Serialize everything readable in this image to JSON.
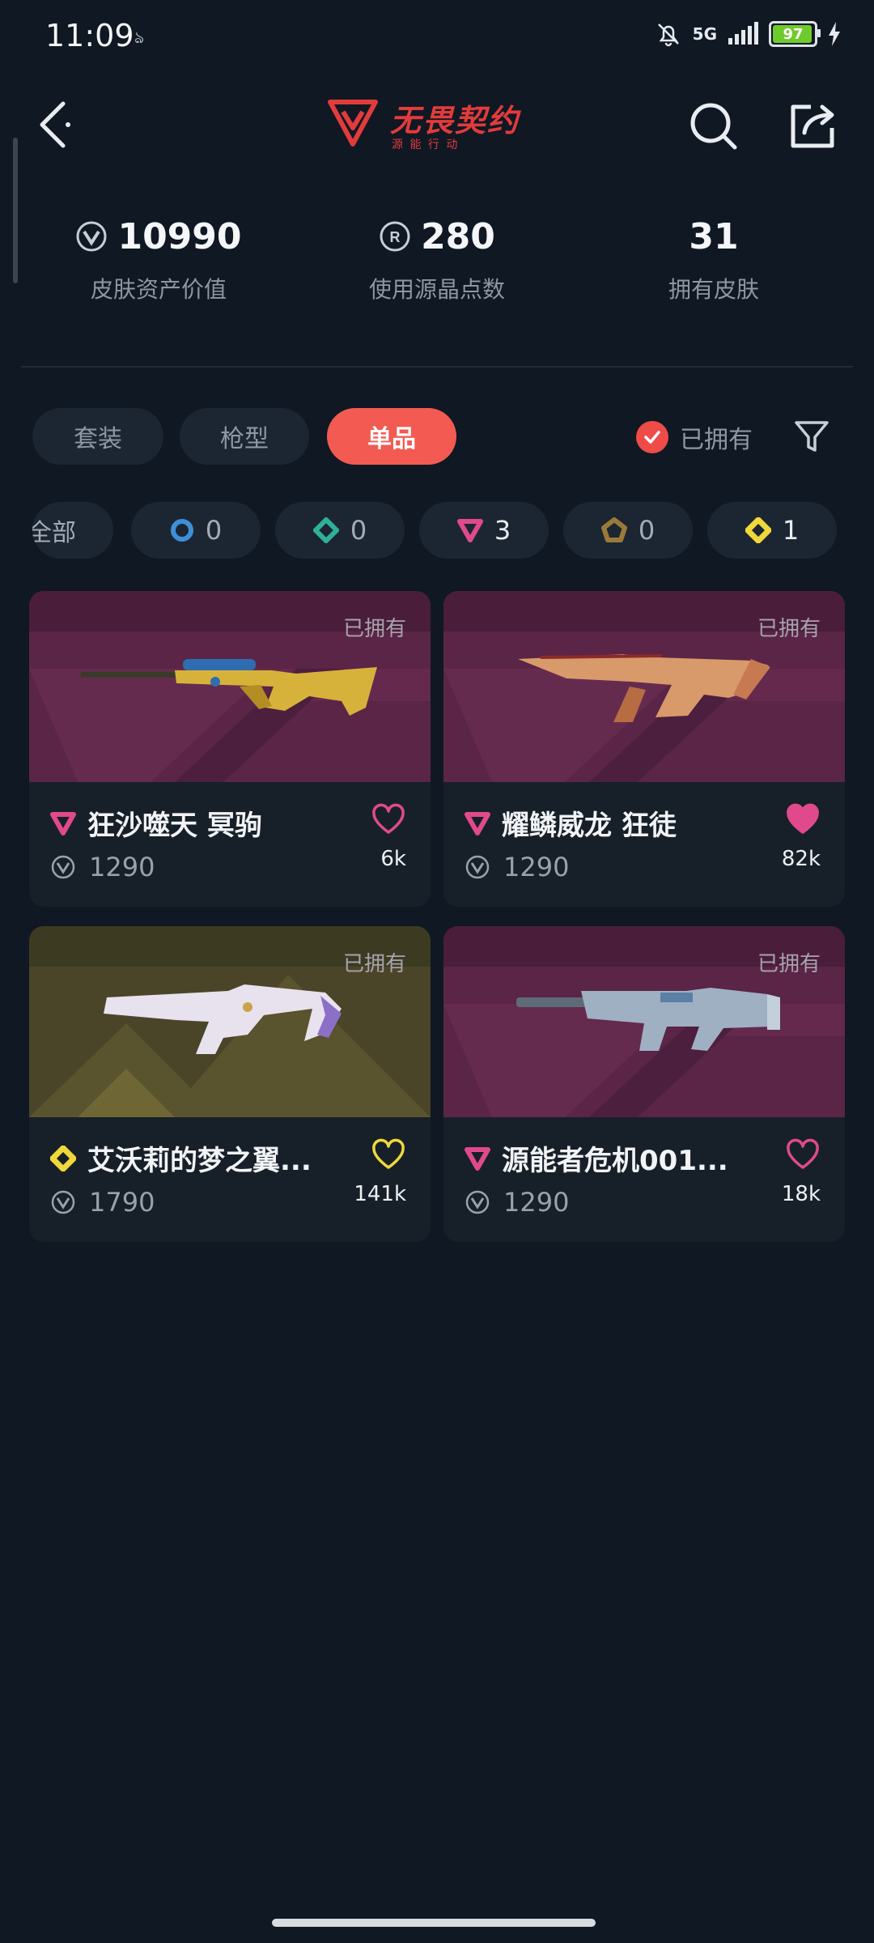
{
  "status_bar": {
    "time": "11:09",
    "network": "5G",
    "battery": "97"
  },
  "header": {
    "logo_title": "无畏契约",
    "logo_subtitle": "源 能 行 动"
  },
  "stats": [
    {
      "value": "10990",
      "label": "皮肤资产价值",
      "icon": "vp-coin-icon"
    },
    {
      "value": "280",
      "label": "使用源晶点数",
      "icon": "radianite-icon"
    },
    {
      "value": "31",
      "label": "拥有皮肤"
    }
  ],
  "tabs": [
    {
      "label": "套装",
      "active": false
    },
    {
      "label": "枪型",
      "active": false
    },
    {
      "label": "单品",
      "active": true
    }
  ],
  "owned_filter": {
    "label": "已拥有",
    "checked": true
  },
  "rarity_chips": [
    {
      "label": "全部"
    },
    {
      "count": "0",
      "tier": "select",
      "color": "#3f8fd6"
    },
    {
      "count": "0",
      "tier": "deluxe",
      "color": "#2fb09a"
    },
    {
      "count": "3",
      "tier": "premium",
      "color": "#e04a8c"
    },
    {
      "count": "0",
      "tier": "ultra",
      "color": "#9a7a3a"
    },
    {
      "count": "1",
      "tier": "exclusive",
      "color": "#f1d83a"
    }
  ],
  "skins": [
    {
      "name": "狂沙噬天 冥驹",
      "price": "1290",
      "likes": "6k",
      "owned": "已拥有",
      "tier_color": "#e04a8c",
      "liked": false
    },
    {
      "name": "耀鳞威龙 狂徒",
      "price": "1290",
      "likes": "82k",
      "owned": "已拥有",
      "tier_color": "#e04a8c",
      "liked": true
    },
    {
      "name": "艾沃莉的梦之翼...",
      "price": "1790",
      "likes": "141k",
      "owned": "已拥有",
      "tier_color": "#f1d83a",
      "liked": false
    },
    {
      "name": "源能者危机001...",
      "price": "1290",
      "likes": "18k",
      "owned": "已拥有",
      "tier_color": "#e04a8c",
      "liked": false
    }
  ]
}
